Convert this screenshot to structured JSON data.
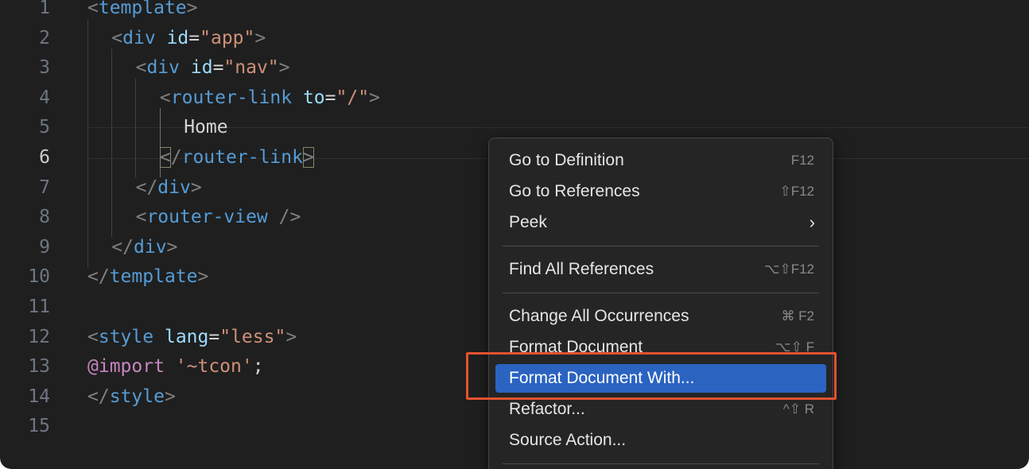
{
  "editor": {
    "lines": [
      {
        "n": "1",
        "tokens": [
          {
            "c": "t-punct",
            "t": "<"
          },
          {
            "c": "t-tag",
            "t": "template"
          },
          {
            "c": "t-punct",
            "t": ">"
          }
        ]
      },
      {
        "n": "2",
        "tokens": [
          {
            "c": "t-punct",
            "t": "<"
          },
          {
            "c": "t-tag",
            "t": "div"
          },
          {
            "c": "t-text",
            "t": " "
          },
          {
            "c": "t-attr",
            "t": "id"
          },
          {
            "c": "t-eq",
            "t": "="
          },
          {
            "c": "t-str",
            "t": "\"app\""
          },
          {
            "c": "t-punct",
            "t": ">"
          }
        ]
      },
      {
        "n": "3",
        "tokens": [
          {
            "c": "t-punct",
            "t": "<"
          },
          {
            "c": "t-tag",
            "t": "div"
          },
          {
            "c": "t-text",
            "t": " "
          },
          {
            "c": "t-attr",
            "t": "id"
          },
          {
            "c": "t-eq",
            "t": "="
          },
          {
            "c": "t-str",
            "t": "\"nav\""
          },
          {
            "c": "t-punct",
            "t": ">"
          }
        ]
      },
      {
        "n": "4",
        "tokens": [
          {
            "c": "t-punct",
            "t": "<"
          },
          {
            "c": "t-tag",
            "t": "router-link"
          },
          {
            "c": "t-text",
            "t": " "
          },
          {
            "c": "t-attr",
            "t": "to"
          },
          {
            "c": "t-eq",
            "t": "="
          },
          {
            "c": "t-str",
            "t": "\"/\""
          },
          {
            "c": "t-punct",
            "t": ">"
          }
        ]
      },
      {
        "n": "5",
        "tokens": [
          {
            "c": "t-text",
            "t": "Home"
          }
        ]
      },
      {
        "n": "6",
        "tokens": [
          {
            "c": "t-punct bracket-box",
            "t": "<"
          },
          {
            "c": "t-punct",
            "t": "/"
          },
          {
            "c": "t-tag",
            "t": "router-link"
          },
          {
            "c": "t-punct bracket-box",
            "t": ">"
          }
        ]
      },
      {
        "n": "7",
        "tokens": [
          {
            "c": "t-punct",
            "t": "</"
          },
          {
            "c": "t-tag",
            "t": "div"
          },
          {
            "c": "t-punct",
            "t": ">"
          }
        ]
      },
      {
        "n": "8",
        "tokens": [
          {
            "c": "t-punct",
            "t": "<"
          },
          {
            "c": "t-tag",
            "t": "router-view"
          },
          {
            "c": "t-text",
            "t": " "
          },
          {
            "c": "t-punct",
            "t": "/>"
          }
        ]
      },
      {
        "n": "9",
        "tokens": [
          {
            "c": "t-punct",
            "t": "</"
          },
          {
            "c": "t-tag",
            "t": "div"
          },
          {
            "c": "t-punct",
            "t": ">"
          }
        ]
      },
      {
        "n": "10",
        "tokens": [
          {
            "c": "t-punct",
            "t": "</"
          },
          {
            "c": "t-tag",
            "t": "template"
          },
          {
            "c": "t-punct",
            "t": ">"
          }
        ]
      },
      {
        "n": "11",
        "tokens": []
      },
      {
        "n": "12",
        "tokens": [
          {
            "c": "t-punct",
            "t": "<"
          },
          {
            "c": "t-tag",
            "t": "style"
          },
          {
            "c": "t-text",
            "t": " "
          },
          {
            "c": "t-attr",
            "t": "lang"
          },
          {
            "c": "t-eq",
            "t": "="
          },
          {
            "c": "t-str",
            "t": "\"less\""
          },
          {
            "c": "t-punct",
            "t": ">"
          }
        ]
      },
      {
        "n": "13",
        "tokens": [
          {
            "c": "t-at",
            "t": "@import"
          },
          {
            "c": "t-text",
            "t": " "
          },
          {
            "c": "t-str",
            "t": "'~tcon'"
          },
          {
            "c": "t-text",
            "t": ";"
          }
        ]
      },
      {
        "n": "14",
        "tokens": [
          {
            "c": "t-punct",
            "t": "</"
          },
          {
            "c": "t-tag",
            "t": "style"
          },
          {
            "c": "t-punct",
            "t": ">"
          }
        ]
      },
      {
        "n": "15",
        "tokens": []
      }
    ],
    "active_line": "6"
  },
  "context_menu": {
    "items": [
      {
        "label": "Go to Definition",
        "shortcut": "F12"
      },
      {
        "label": "Go to References",
        "shortcut": "⇧F12"
      },
      {
        "label": "Peek",
        "shortcut": "›"
      },
      {
        "label": "Find All References",
        "shortcut": "⌥⇧F12"
      },
      {
        "label": "Change All Occurrences",
        "shortcut": "⌘ F2"
      },
      {
        "label": "Format Document",
        "shortcut": "⌥⇧ F"
      },
      {
        "label": "Format Document With...",
        "shortcut": ""
      },
      {
        "label": "Refactor...",
        "shortcut": "^⇧ R"
      },
      {
        "label": "Source Action...",
        "shortcut": ""
      }
    ],
    "selected_item": "Format Document With...",
    "highlight_color": "#e2522f",
    "selection_color": "#2b63c1"
  }
}
